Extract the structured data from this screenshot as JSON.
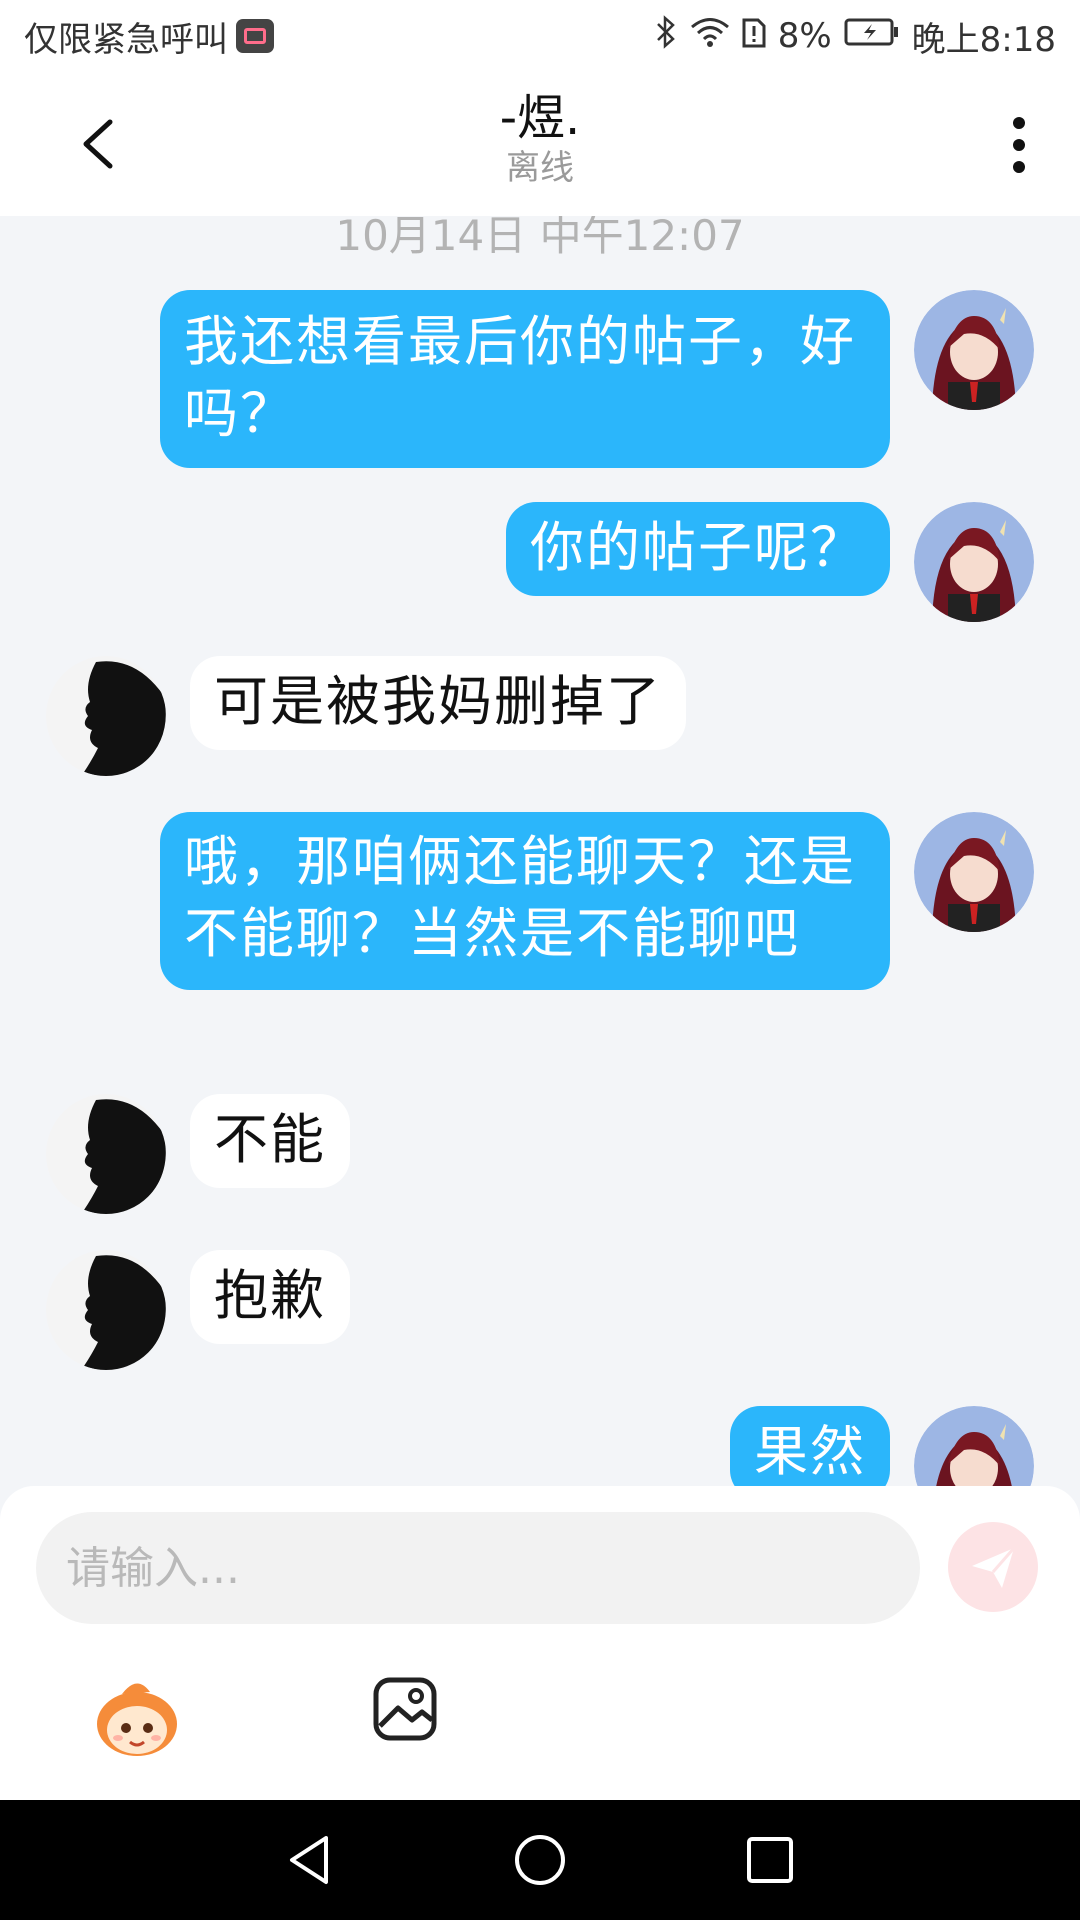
{
  "status_bar": {
    "carrier_text": "仅限紧急呼叫",
    "battery": "8%",
    "time": "晚上8:18"
  },
  "header": {
    "name": "-煜.",
    "status": "离线"
  },
  "chat": {
    "timestamp": "10月14日 中午12:07",
    "messages": [
      {
        "direction": "out",
        "text": "我还想看最后你的帖子，好吗？"
      },
      {
        "direction": "out",
        "text": "你的帖子呢？"
      },
      {
        "direction": "in",
        "text": "可是被我妈删掉了"
      },
      {
        "direction": "out",
        "text": "哦，那咱俩还能聊天？还是不能聊？当然是不能聊吧"
      },
      {
        "direction": "in",
        "text": "不能"
      },
      {
        "direction": "in",
        "text": "抱歉"
      },
      {
        "direction": "out",
        "text": "果然"
      }
    ]
  },
  "input": {
    "placeholder": "请输入..."
  },
  "colors": {
    "outgoing_bubble": "#2bb6fb",
    "incoming_bubble": "#ffffff",
    "send_button": "#fde3e5"
  },
  "icons": [
    "back-arrow-icon",
    "more-vert-icon",
    "send-icon",
    "emoji-icon",
    "image-icon",
    "nav-back-icon",
    "nav-home-icon",
    "nav-recents-icon"
  ]
}
